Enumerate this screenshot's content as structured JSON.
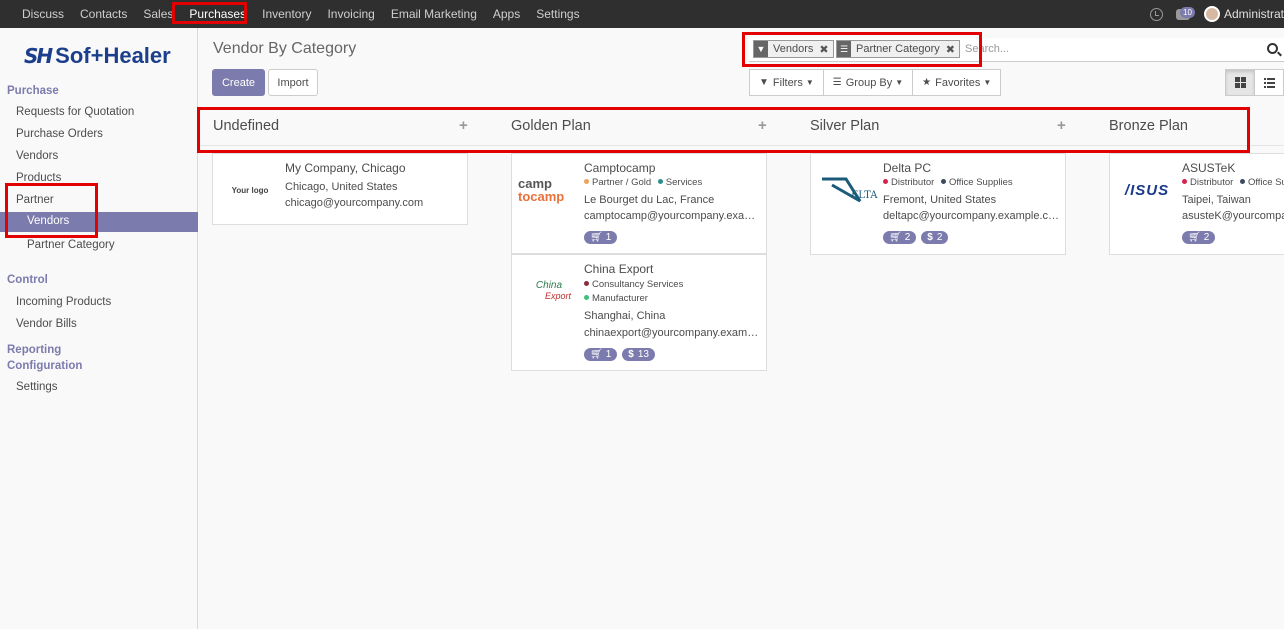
{
  "topnav": [
    {
      "label": "Discuss"
    },
    {
      "label": "Contacts"
    },
    {
      "label": "Sales"
    },
    {
      "label": "Purchases"
    },
    {
      "label": "Inventory"
    },
    {
      "label": "Invoicing"
    },
    {
      "label": "Email Marketing"
    },
    {
      "label": "Apps"
    },
    {
      "label": "Settings"
    }
  ],
  "topright": {
    "chat_count": "10",
    "user": "Administrator"
  },
  "logo": {
    "mark": "SH",
    "word": "Sof+Healer"
  },
  "sidebar": {
    "section_purchase": "Purchase",
    "rfq": "Requests for Quotation",
    "orders": "Purchase Orders",
    "vendors": "Vendors",
    "products": "Products",
    "partner": "Partner",
    "partner_vendors": "Vendors",
    "partner_category": "Partner Category",
    "section_control": "Control",
    "incoming": "Incoming Products",
    "bills": "Vendor Bills",
    "section_reporting": "Reporting",
    "section_config": "Configuration",
    "settings": "Settings"
  },
  "page": {
    "title": "Vendor By Category",
    "create": "Create",
    "import": "Import"
  },
  "search": {
    "facets": [
      {
        "icon": "filter-icon",
        "label": "Vendors"
      },
      {
        "icon": "list-icon",
        "label": "Partner Category"
      }
    ],
    "placeholder": "Search..."
  },
  "filters": {
    "filters": "Filters",
    "group_by": "Group By",
    "favorites": "Favorites"
  },
  "columns": [
    {
      "name": "Undefined",
      "plus": "+"
    },
    {
      "name": "Golden Plan",
      "plus": "+"
    },
    {
      "name": "Silver Plan",
      "plus": "+"
    },
    {
      "name": "Bronze Plan"
    }
  ],
  "cards": {
    "mycompany": {
      "logo": "Your logo",
      "name": "My Company, Chicago",
      "city": "Chicago, United States",
      "email": "chicago@yourcompany.com"
    },
    "camptocamp": {
      "logo_top": "camp",
      "logo_bottom": "tocamp",
      "name": "Camptocamp",
      "tags": [
        {
          "label": "Partner / Gold",
          "color": "#f0a05a"
        },
        {
          "label": "Services",
          "color": "#2f8f8f"
        }
      ],
      "city": "Le Bourget du Lac, France",
      "email": "camptocamp@yourcompany.exa…",
      "pills": [
        {
          "icon": "cart-icon",
          "value": "1"
        }
      ]
    },
    "chinaexport": {
      "logo_top": "China",
      "logo_bottom": "Export",
      "name": "China Export",
      "tags": [
        {
          "label": "Consultancy Services",
          "color": "#8a2d3d"
        },
        {
          "label": "Manufacturer",
          "color": "#3fbf7f"
        }
      ],
      "city": "Shanghai, China",
      "email": "chinaexport@yourcompany.exam…",
      "pills": [
        {
          "icon": "cart-icon",
          "value": "1"
        },
        {
          "icon": "dollar-icon",
          "value": "13"
        }
      ]
    },
    "deltapc": {
      "logo": "ELTA",
      "name": "Delta PC",
      "tags": [
        {
          "label": "Distributor",
          "color": "#d4244e"
        },
        {
          "label": "Office Supplies",
          "color": "#3d4a5f"
        }
      ],
      "city": "Fremont, United States",
      "email": "deltapc@yourcompany.example.c…",
      "pills": [
        {
          "icon": "cart-icon",
          "value": "2"
        },
        {
          "icon": "dollar-icon",
          "value": "2"
        }
      ]
    },
    "asustek": {
      "logo": "/ISUS",
      "name": "ASUSTeK",
      "tags": [
        {
          "label": "Distributor",
          "color": "#d4244e"
        },
        {
          "label": "Office Supplies",
          "color": "#3d4a5f"
        }
      ],
      "city": "Taipei, Taiwan",
      "email": "asusteK@yourcompany.example",
      "pills": [
        {
          "icon": "cart-icon",
          "value": "2"
        }
      ]
    }
  },
  "colors": {
    "accent": "#7c7bad",
    "highlight": "#e30000",
    "topbar": "#2f2f2f"
  }
}
